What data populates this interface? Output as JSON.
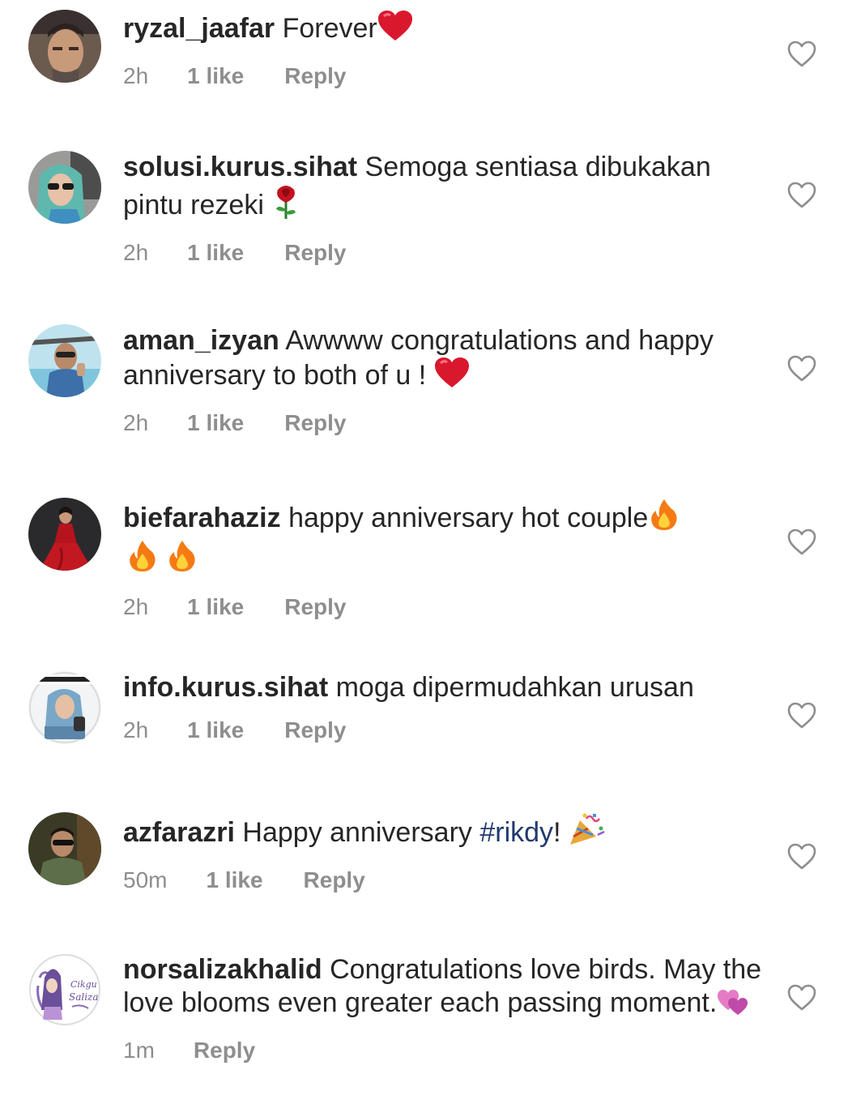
{
  "comments": [
    {
      "username": "ryzal_jaafar",
      "text": "Forever",
      "emoji": [
        "red-heart"
      ],
      "time": "2h",
      "likes": "1 like",
      "reply": "Reply"
    },
    {
      "username": "solusi.kurus.sihat",
      "text": "Semoga sentiasa dibukakan pintu rezeki",
      "emoji": [
        "rose"
      ],
      "time": "2h",
      "likes": "1 like",
      "reply": "Reply"
    },
    {
      "username": "aman_izyan",
      "text": "Awwww congratulations and happy anniversary to both of u !",
      "emoji": [
        "red-heart"
      ],
      "time": "2h",
      "likes": "1 like",
      "reply": "Reply"
    },
    {
      "username": "biefarahaziz",
      "text": "happy anniversary hot couple",
      "emoji": [
        "fire",
        "fire",
        "fire"
      ],
      "time": "2h",
      "likes": "1 like",
      "reply": "Reply"
    },
    {
      "username": "info.kurus.sihat",
      "text": "moga dipermudahkan urusan",
      "time": "2h",
      "likes": "1 like",
      "reply": "Reply"
    },
    {
      "username": "azfarazri",
      "text": "Happy anniversary",
      "hashtag": "#rikdy",
      "suffix": "!",
      "emoji": [
        "party-popper"
      ],
      "time": "50m",
      "likes": "1 like",
      "reply": "Reply"
    },
    {
      "username": "norsalizakhalid",
      "text": "Congratulations love birds. May the love blooms even greater each passing moment.",
      "emoji": [
        "two-hearts"
      ],
      "time": "1m",
      "reply": "Reply"
    }
  ],
  "colors": {
    "text": "#262626",
    "meta": "#8e8e8e",
    "hashtag": "#1f3a6e",
    "heart_icon": "#8e8e8e"
  },
  "icons": {
    "like": "heart-outline-icon"
  }
}
